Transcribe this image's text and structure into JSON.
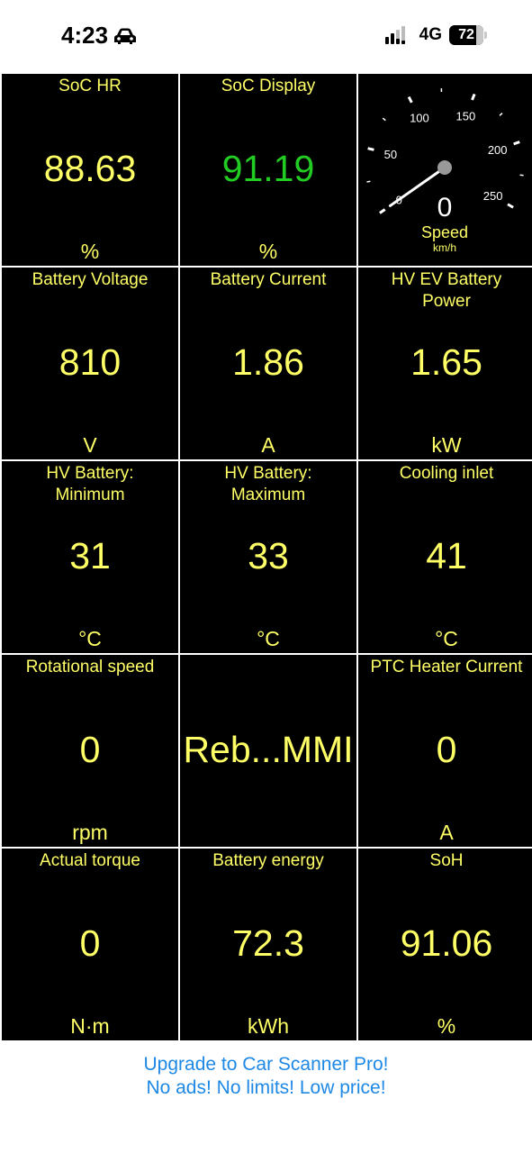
{
  "status_bar": {
    "time": "4:23",
    "network": "4G",
    "battery_level": "72",
    "icons": [
      "car-icon",
      "signal-icon",
      "battery-icon"
    ]
  },
  "gauge": {
    "value": "0",
    "label": "Speed",
    "unit": "km/h",
    "ticks": [
      "0",
      "50",
      "100",
      "150",
      "200",
      "250"
    ],
    "range": [
      0,
      260
    ]
  },
  "tiles": [
    {
      "label": "SoC HR",
      "value": "88.63",
      "unit": "%",
      "color": "#ffff66"
    },
    {
      "label": "SoC Display",
      "value": "91.19",
      "unit": "%",
      "color": "#22cc22"
    },
    {
      "label": "Battery Voltage",
      "value": "810",
      "unit": "V",
      "color": "#ffff66"
    },
    {
      "label": "Battery Current",
      "value": "1.86",
      "unit": "A",
      "color": "#ffff66"
    },
    {
      "label": "HV EV Battery\nPower",
      "value": "1.65",
      "unit": "kW",
      "color": "#ffff66"
    },
    {
      "label": "HV Battery:\nMinimum",
      "value": "31",
      "unit": "°C",
      "color": "#ffff66"
    },
    {
      "label": "HV Battery:\nMaximum",
      "value": "33",
      "unit": "°C",
      "color": "#ffff66"
    },
    {
      "label": "Cooling inlet",
      "value": "41",
      "unit": "°C",
      "color": "#ffff66"
    },
    {
      "label": "Rotational speed",
      "value": "0",
      "unit": "rpm",
      "color": "#ffff66"
    },
    {
      "label": "",
      "value": "Reb...MMI",
      "unit": "",
      "color": "#ffff66"
    },
    {
      "label": "PTC Heater Current",
      "value": "0",
      "unit": "A",
      "color": "#ffff66"
    },
    {
      "label": "Actual torque",
      "value": "0",
      "unit": "N·m",
      "color": "#ffff66"
    },
    {
      "label": "Battery energy",
      "value": "72.3",
      "unit": "kWh",
      "color": "#ffff66"
    },
    {
      "label": "SoH",
      "value": "91.06",
      "unit": "%",
      "color": "#ffff66"
    }
  ],
  "ad": {
    "line1": "Upgrade to Car Scanner Pro!",
    "line2": "No ads! No limits! Low price!",
    "color": "#1e88e5"
  }
}
